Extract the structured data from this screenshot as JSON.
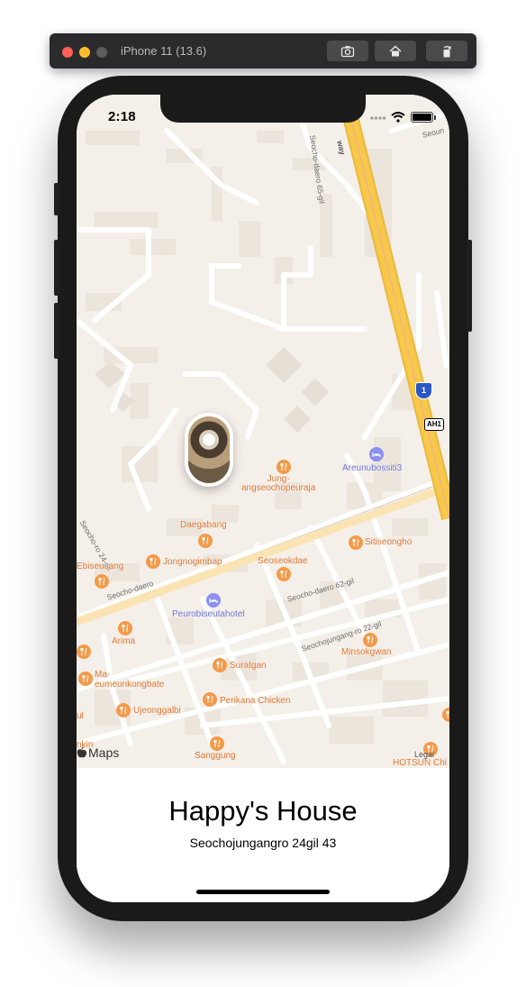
{
  "simulator": {
    "title": "iPhone 11 (13.6)",
    "buttons": [
      {
        "name": "screenshot",
        "icon": "camera-icon"
      },
      {
        "name": "home",
        "icon": "home-icon"
      },
      {
        "name": "rotate",
        "icon": "rotate-icon"
      }
    ]
  },
  "status_bar": {
    "time": "2:18"
  },
  "map": {
    "streets": [
      "Seocho-daero 65-gil",
      "Seocho-daero",
      "Seocho-daero 62-gil",
      "Seochojungang-ro 22-gil",
      "Seocho-ro 24-gil",
      "Seoun",
      "way"
    ],
    "highway_shields": [
      "1",
      "AH1"
    ],
    "pois": [
      {
        "label": "Jung-\nangseochopeuraja",
        "kind": "food"
      },
      {
        "label": "Areunubossiti3",
        "kind": "hotel"
      },
      {
        "label": "Daegabang",
        "kind": "food"
      },
      {
        "label": "Sitiseongho",
        "kind": "food"
      },
      {
        "label": "Ebiseusang",
        "kind": "food"
      },
      {
        "label": "Jongnogimbap",
        "kind": "food"
      },
      {
        "label": "Seoseokdae",
        "kind": "food"
      },
      {
        "label": "Peurobiseutahotel",
        "kind": "hotel"
      },
      {
        "label": "Arima",
        "kind": "food"
      },
      {
        "label": "Minsokgwan",
        "kind": "food"
      },
      {
        "label": "Ma-\neumeunkongbate",
        "kind": "food"
      },
      {
        "label": "Suratgan",
        "kind": "food"
      },
      {
        "label": "Perikana Chicken",
        "kind": "food"
      },
      {
        "label": "Ujeonggalbi",
        "kind": "food"
      },
      {
        "label": "Sanggung",
        "kind": "food"
      },
      {
        "label": "HOTSUN Chi",
        "kind": "food"
      },
      {
        "label": "ul",
        "kind": "food"
      },
      {
        "label": "nkin",
        "kind": "food"
      }
    ],
    "attribution": "Maps",
    "legal": "Legal"
  },
  "place": {
    "title": "Happy's House",
    "address": "Seochojungangro 24gil 43"
  },
  "colors": {
    "map_bg": "#f4efe8",
    "road": "#ffffff",
    "highway": "#f7c94a",
    "poi_food": "#f39a4a",
    "poi_hotel": "#8a8ff0"
  }
}
